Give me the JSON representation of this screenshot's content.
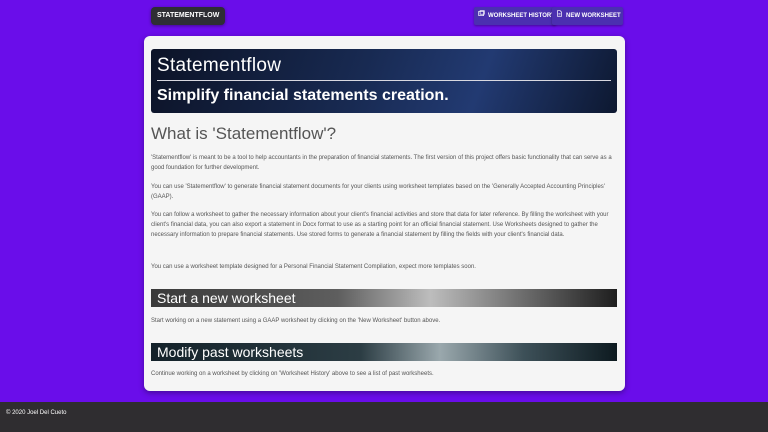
{
  "navbar": {
    "brand": "STATEMENTFLOW",
    "history_label": "WORKSHEET HISTORY",
    "new_label": "NEW WORKSHEET"
  },
  "hero": {
    "title": "Statementflow",
    "subtitle": "Simplify financial statements creation."
  },
  "about": {
    "heading": "What is 'Statementflow'?",
    "paragraphs": [
      "'Statementflow' is meant to be a tool to help accountants in the preparation of financial statements. The first version of this project offers basic functionality that can serve as a good foundation for further development.",
      "You can use 'Statementflow' to generate financial statement documents for your clients using worksheet templates based on the 'Generally Accepted Accounting Principles' (GAAP).",
      "You can follow a worksheet to gather the necessary information about your client's financial activities and store that data for later reference. By filling the worksheet with your client's financial data, you can also export a statement in Docx format to use as a starting point for an official financial statement. Use Worksheets designed to gather the necessary information to prepare financial statements. Use stored forms to generate a financial statement by filling the fields with your client's financial data.",
      "You can use a worksheet template designed for a Personal Financial Statement Compilation, expect more templates soon."
    ]
  },
  "start": {
    "heading": "Start a new worksheet",
    "text": "Start working on a new statement using a GAAP worksheet by clicking on the 'New Worksheet' button above."
  },
  "modify": {
    "heading": "Modify past worksheets",
    "text": "Continue working on a worksheet by clicking on 'Worksheet History' above to see a list of past worksheets."
  },
  "footer": {
    "text": "© 2020 Joel Del Cueto"
  },
  "colors": {
    "background": "#6a0dea",
    "footer": "#2f2d30",
    "nav_button": "#4b2fb0",
    "brand": "#2e2e34"
  }
}
